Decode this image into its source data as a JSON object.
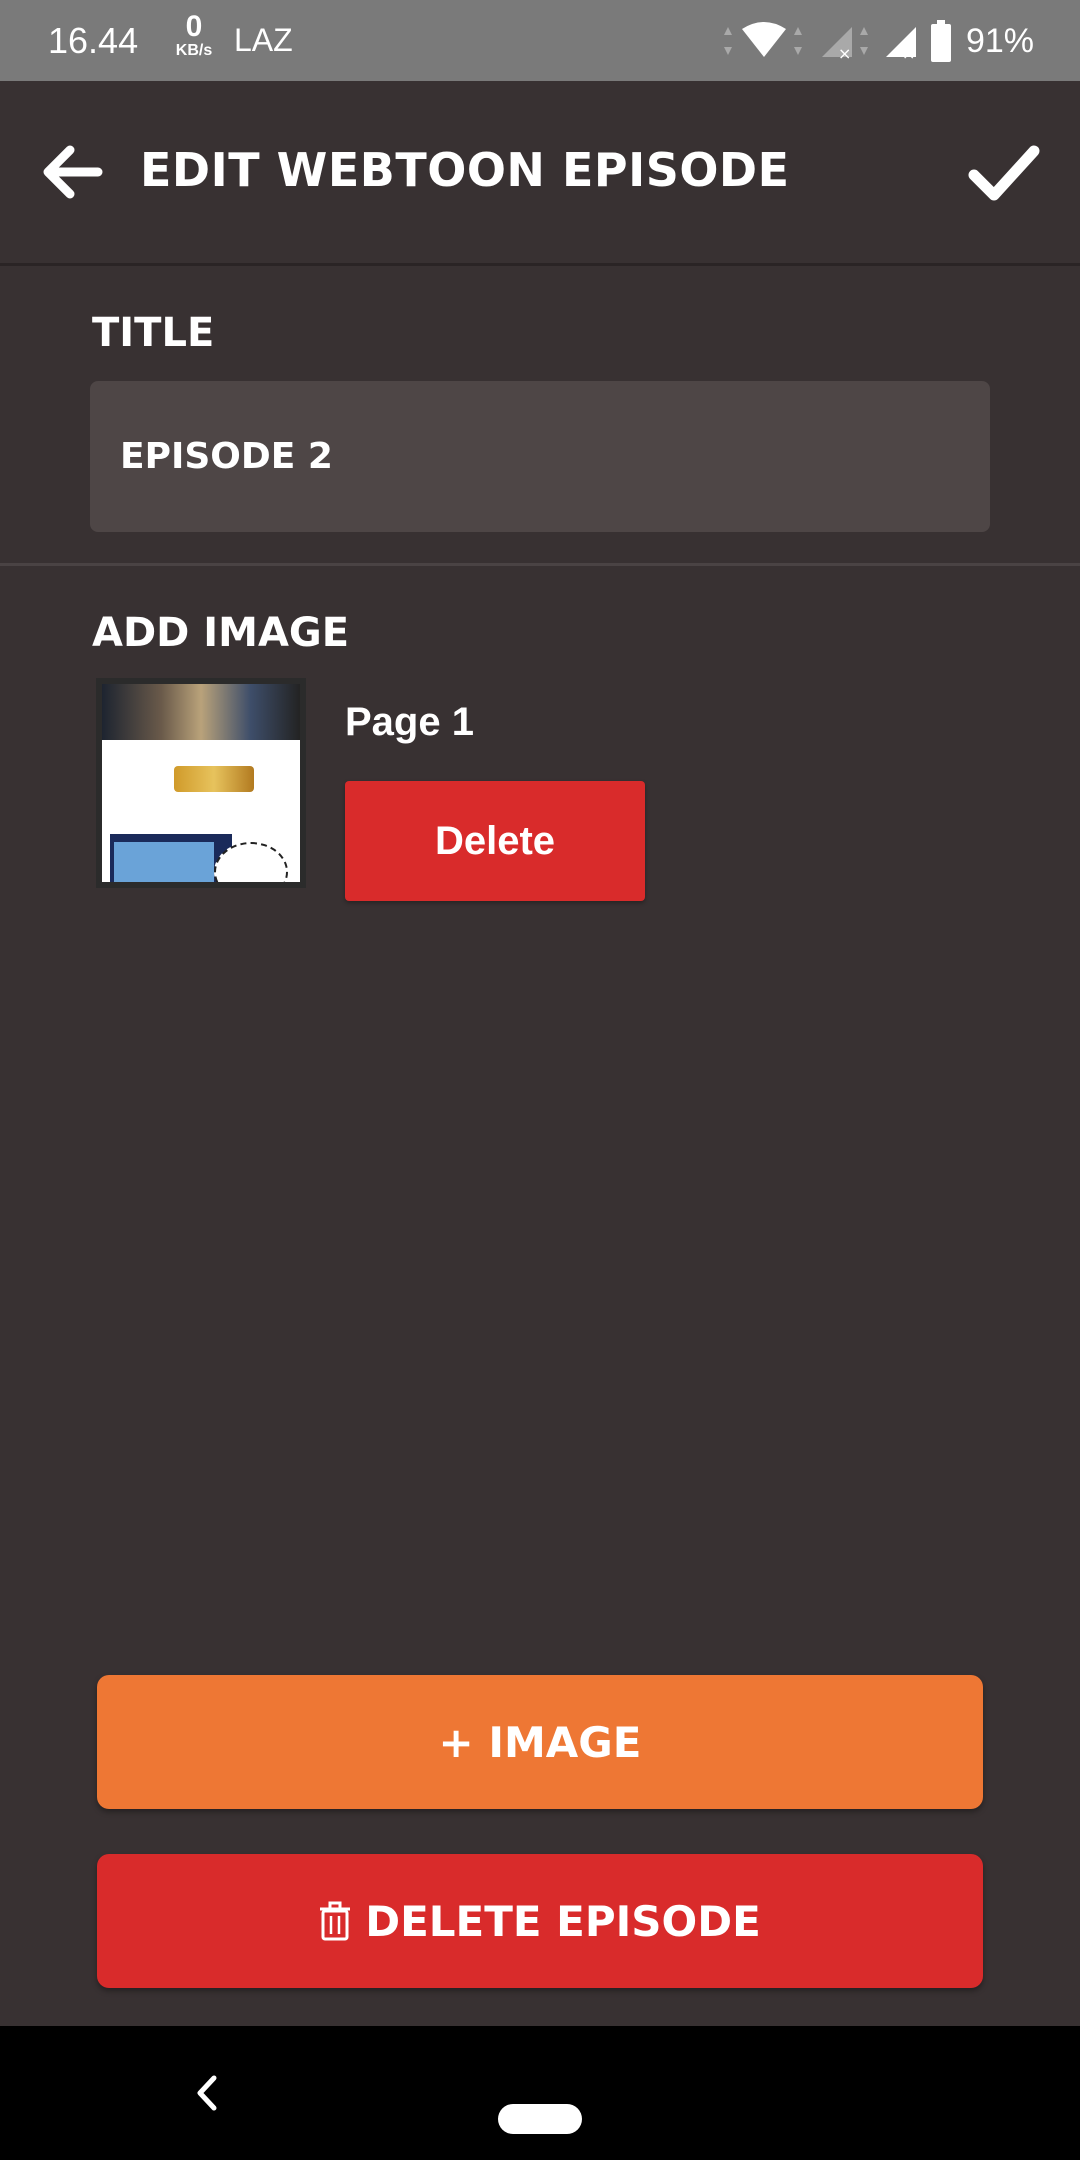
{
  "status_bar": {
    "time": "16.44",
    "speed_value": "0",
    "speed_unit": "KB/s",
    "carrier": "LAZ",
    "battery_percent": "91%"
  },
  "app_bar": {
    "title": "EDIT WEBTOON EPISODE"
  },
  "form": {
    "title_label": "TITLE",
    "title_value": "EPISODE 2",
    "add_image_label": "ADD IMAGE"
  },
  "images": [
    {
      "label": "Page 1",
      "delete_label": "Delete"
    }
  ],
  "actions": {
    "add_image_label": "+ IMAGE",
    "delete_episode_label": "DELETE EPISODE"
  },
  "colors": {
    "background": "#383132",
    "input_bg": "#4e4646",
    "accent_orange": "#ee7734",
    "danger_red": "#d92b2b"
  },
  "icons": {
    "back": "arrow-left-icon",
    "confirm": "checkmark-icon",
    "trash": "trash-icon"
  }
}
